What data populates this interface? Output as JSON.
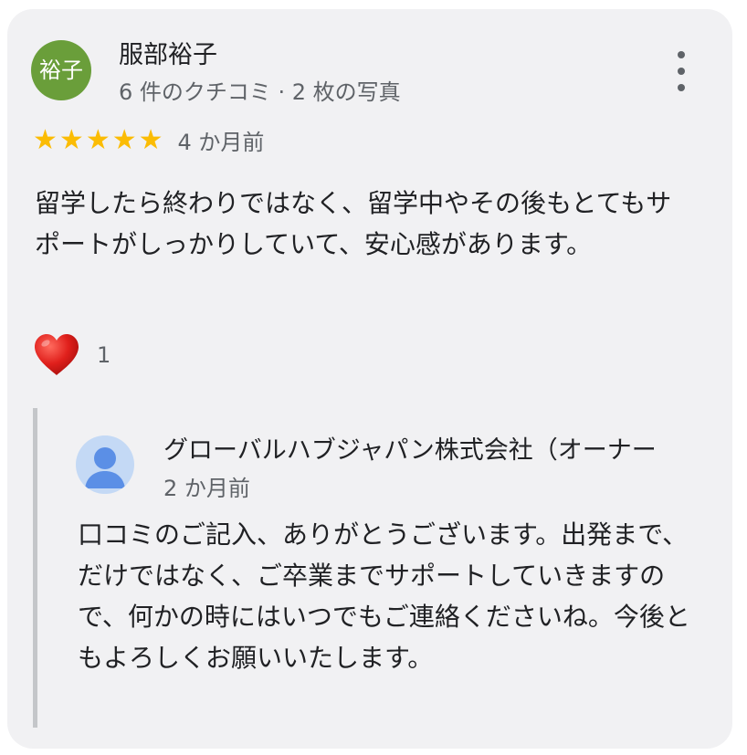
{
  "review": {
    "avatar_text": "裕子",
    "reviewer_name": "服部裕子",
    "reviewer_meta": "6 件のクチコミ · 2 枚の写真",
    "rating": 5,
    "stars": [
      "★",
      "★",
      "★",
      "★",
      "★"
    ],
    "time_ago": "4 か月前",
    "text": "留学したら終わりではなく、留学中やその後もとてもサポートがしっかりしていて、安心感があります。",
    "reaction_count": "1"
  },
  "owner_reply": {
    "owner_name": "グローバルハブジャパン株式会社（オーナー",
    "time_ago": "2 か月前",
    "text": "口コミのご記入、ありがとうございます。出発まで、だけではなく、ご卒業までサポートしていきますので、何かの時にはいつでもご連絡くださいね。今後ともよろしくお願いいたします。"
  },
  "colors": {
    "avatar": "#6a9e3a",
    "star": "#fbbc04",
    "heart": "#e0201c",
    "card_background": "#f1f1f3",
    "reply_avatar": "#c4d9f5"
  }
}
